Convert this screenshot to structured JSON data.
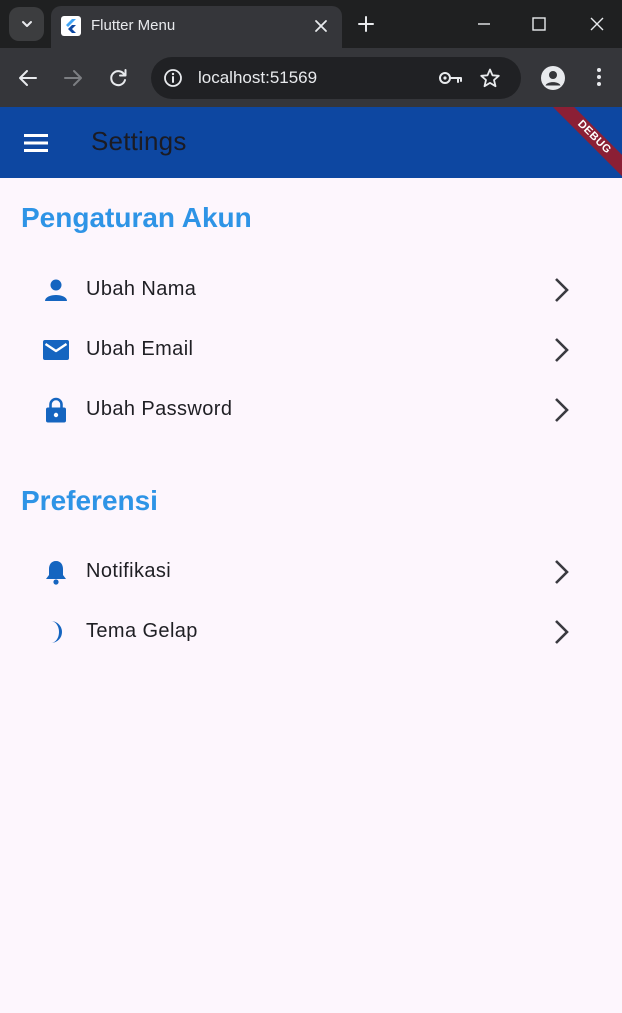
{
  "browser": {
    "tab_title": "Flutter Menu",
    "url": "localhost:51569",
    "icons": {
      "tab_search": "chevron-down-icon",
      "favicon": "flutter-logo-icon",
      "tab_close": "close-icon",
      "new_tab": "plus-icon",
      "minimize": "minimize-icon",
      "maximize": "maximize-icon",
      "window_close": "close-icon",
      "back": "arrow-left-icon",
      "forward": "arrow-right-icon",
      "reload": "reload-icon",
      "site_info": "info-icon",
      "password": "key-icon",
      "bookmark": "star-icon",
      "profile": "profile-icon",
      "menu": "kebab-icon"
    }
  },
  "app": {
    "title": "Settings",
    "debug_label": "DEBUG",
    "colors": {
      "appbar": "#0d47a1",
      "section_title": "#2e94e6",
      "icon": "#1565c0",
      "background": "#fdf6fd",
      "debug_banner": "#8b1f35"
    },
    "sections": [
      {
        "title": "Pengaturan Akun",
        "items": [
          {
            "label": "Ubah Nama",
            "icon": "person-icon"
          },
          {
            "label": "Ubah Email",
            "icon": "email-icon"
          },
          {
            "label": "Ubah Password",
            "icon": "lock-icon"
          }
        ]
      },
      {
        "title": "Preferensi",
        "items": [
          {
            "label": "Notifikasi",
            "icon": "bell-icon"
          },
          {
            "label": "Tema Gelap",
            "icon": "moon-icon"
          }
        ]
      }
    ]
  }
}
